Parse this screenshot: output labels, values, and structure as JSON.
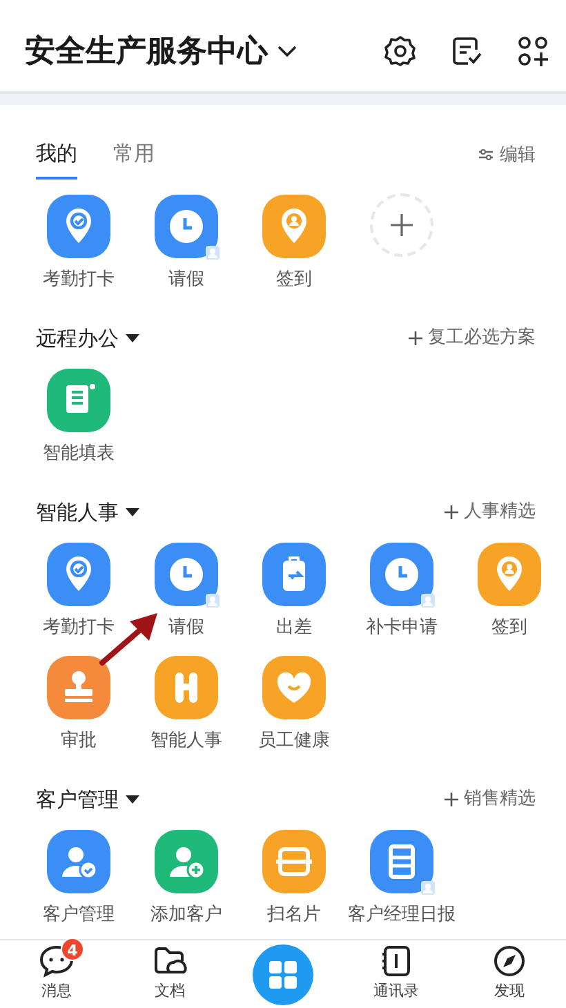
{
  "header": {
    "title": "安全生产服务中心"
  },
  "tabs": [
    {
      "label": "我的",
      "selected": true
    },
    {
      "label": "常用",
      "selected": false
    }
  ],
  "edit_link": "编辑",
  "my_apps": [
    {
      "label": "考勤打卡",
      "kind": "pin-check",
      "color": "#3a8ef6"
    },
    {
      "label": "请假",
      "kind": "clock",
      "color": "#3a8ef6",
      "badge": true
    },
    {
      "label": "签到",
      "kind": "pin-person",
      "color": "#f7a325"
    },
    {
      "kind": "add"
    }
  ],
  "sections": [
    {
      "title": "远程办公",
      "action": "复工必选方案",
      "apps": [
        {
          "label": "智能填表",
          "kind": "form",
          "color": "#1fb97a"
        }
      ]
    },
    {
      "title": "智能人事",
      "action": "人事精选",
      "apps": [
        {
          "label": "考勤打卡",
          "kind": "pin-check",
          "color": "#3a8ef6"
        },
        {
          "label": "请假",
          "kind": "clock",
          "color": "#3a8ef6",
          "badge": true
        },
        {
          "label": "出差",
          "kind": "suitcase",
          "color": "#3a8ef6"
        },
        {
          "label": "补卡申请",
          "kind": "clock",
          "color": "#3a8ef6",
          "badge": true
        },
        {
          "label": "签到",
          "kind": "pin-person",
          "color": "#f7a325"
        },
        {
          "label": "审批",
          "kind": "stamp",
          "color": "#f58a3c"
        },
        {
          "label": "智能人事",
          "kind": "h-letter",
          "color": "#f7a325"
        },
        {
          "label": "员工健康",
          "kind": "heart",
          "color": "#f7a325"
        }
      ]
    },
    {
      "title": "客户管理",
      "action": "销售精选",
      "apps": [
        {
          "label": "客户管理",
          "kind": "person-check",
          "color": "#3a8ef6"
        },
        {
          "label": "添加客户",
          "kind": "person-plus",
          "color": "#1fb97a"
        },
        {
          "label": "扫名片",
          "kind": "scan",
          "color": "#f7a325"
        },
        {
          "label": "客户经理日报",
          "kind": "report",
          "color": "#3a8ef6",
          "badge": true
        }
      ]
    }
  ],
  "annotation_arrow": true,
  "bottom_nav": [
    {
      "kind": "chat",
      "label": "消息",
      "badge": "4"
    },
    {
      "kind": "folder",
      "label": "文档"
    },
    {
      "kind": "center"
    },
    {
      "kind": "book",
      "label": "通讯录"
    },
    {
      "kind": "compass",
      "label": "发现"
    }
  ]
}
